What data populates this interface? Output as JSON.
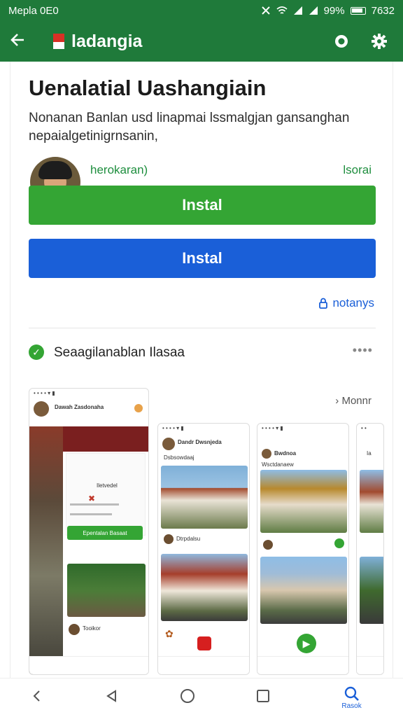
{
  "status_bar": {
    "left": "Mepla 0E0",
    "battery": "99%",
    "time": "7632"
  },
  "app_bar": {
    "title": "ladangia",
    "back_icon": "arrow-left-icon",
    "search_icon": "search-icon",
    "settings_icon": "gear-icon"
  },
  "app": {
    "heading": "Uenalatial Uashangiain",
    "description": "Nonanan Banlan usd linapmai lssmalgjan gansanghan nepaialgetinigrnsanin,",
    "developer": "herokaran)",
    "developer_right": "lsorai",
    "install_primary": "Instal",
    "install_secondary": "Instal",
    "link_text": "notanys"
  },
  "section": {
    "label": "Seaagilanablan Ilasaa",
    "more": "Monnr"
  },
  "screenshots": {
    "s1": {
      "header": "Dawah Zasdonaha",
      "card_title": "Iletvedel",
      "button": "Epentalan Basaat",
      "caption": "Tooikor"
    },
    "s2": {
      "header": "Dandr Dwsnjeda",
      "sub": "Dsbsowdaaj",
      "row": "Dtrpdalsu"
    },
    "s3": {
      "header": "Bwdnoa",
      "sub": "Wsctdanaew"
    },
    "s4": {
      "header": "Ia"
    }
  },
  "sys_nav": {
    "active_label": "Rasok"
  },
  "colors": {
    "app_bar": "#1f7a3a",
    "install_green": "#34a534",
    "install_blue": "#1a5fd8"
  }
}
